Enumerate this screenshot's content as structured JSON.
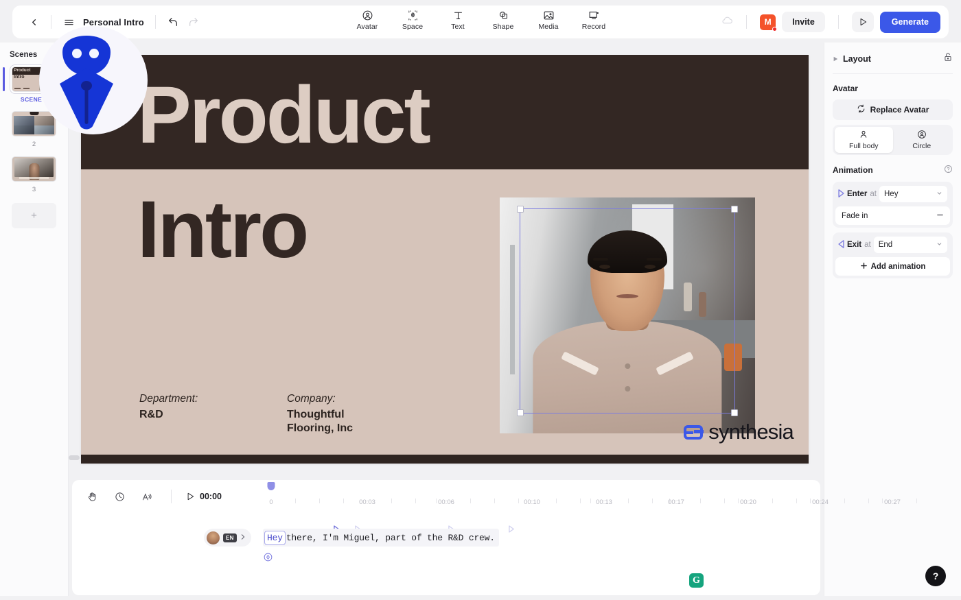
{
  "topbar": {
    "back_icon": "chevron-left-icon",
    "menu_icon": "hamburger-menu-icon",
    "project_title": "Personal Intro",
    "undo_icon": "undo-icon",
    "redo_icon": "redo-icon",
    "tools": [
      {
        "label": "Avatar",
        "icon": "avatar-person-circle-icon"
      },
      {
        "label": "Space",
        "icon": "space-bracket-icon"
      },
      {
        "label": "Text",
        "icon": "text-t-icon"
      },
      {
        "label": "Shape",
        "icon": "shape-square-circle-icon"
      },
      {
        "label": "Media",
        "icon": "media-image-icon"
      },
      {
        "label": "Record",
        "icon": "record-screen-icon"
      }
    ],
    "cloud_icon": "cloud-sync-icon",
    "user_initial": "M",
    "invite_label": "Invite",
    "preview_icon": "play-triangle-icon",
    "generate_label": "Generate",
    "accent_color": "#3b58e8",
    "user_chip_color": "#f4522a"
  },
  "scenes": {
    "title": "Scenes",
    "items": [
      {
        "label": "SCENE 1",
        "active": true,
        "thumb_title_top": "Product",
        "thumb_title_bottom": "Intro"
      },
      {
        "label": "2",
        "active": false
      },
      {
        "label": "3",
        "active": false
      }
    ],
    "add_label": "+"
  },
  "canvas": {
    "title_line1": "Product",
    "title_line2": "Intro",
    "department_label": "Department:",
    "department_value": "R&D",
    "company_label": "Company:",
    "company_value_line1": "Thoughtful",
    "company_value_line2": "Flooring, Inc",
    "brand_name": "synthesia",
    "bg_color": "#d6c4ba",
    "header_color": "#332723",
    "selection_color": "#7c7ce0"
  },
  "right_panel": {
    "layout_label": "Layout",
    "layout_expand_icon": "triangle-right-icon",
    "lock_icon": "unlocked-padlock-icon",
    "avatar_section_label": "Avatar",
    "replace_avatar_label": "Replace Avatar",
    "replace_icon": "refresh-swap-icon",
    "modes": [
      {
        "label": "Full body",
        "icon": "person-icon",
        "active": true
      },
      {
        "label": "Circle",
        "icon": "circle-person-icon",
        "active": false
      }
    ],
    "animation_section_label": "Animation",
    "help_icon": "question-circle-icon",
    "enter_label": "Enter",
    "enter_at_label": "at",
    "enter_value": "Hey",
    "enter_effect": "Fade in",
    "enter_effect_remove_icon": "minus-icon",
    "exit_label": "Exit",
    "exit_at_label": "at",
    "exit_value": "End",
    "add_animation_label": "Add animation",
    "add_icon": "plus-icon"
  },
  "timeline": {
    "tools": [
      {
        "icon": "hand-pan-icon"
      },
      {
        "icon": "clock-timing-icon"
      },
      {
        "icon": "voice-speed-icon"
      }
    ],
    "play_icon": "play-triangle-icon",
    "current_time": "00:00",
    "ticks": [
      "0",
      "00:03",
      "00:06",
      "00:10",
      "00:13",
      "00:17",
      "00:20",
      "00:24",
      "00:27"
    ]
  },
  "script": {
    "speaker_avatar": "speaker-avatar-icon",
    "language_code": "EN",
    "expand_icon": "chevron-right-icon",
    "highlighted_word": "Hey",
    "text": " there, I'm Miguel, part of the R&D crew.",
    "add_marker_icon": "add-marker-icon",
    "grammarly_icon": "grammarly-g-icon"
  },
  "help_fab": {
    "label": "?",
    "icon": "question-mark-icon"
  }
}
